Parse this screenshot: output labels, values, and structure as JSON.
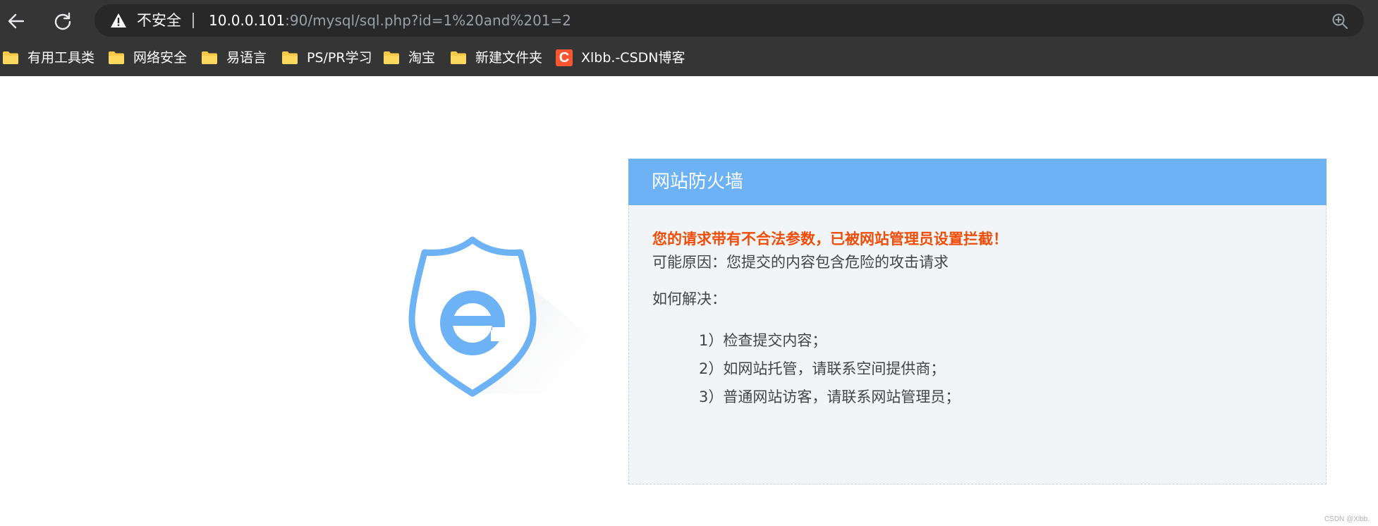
{
  "browser": {
    "security_label": "不安全",
    "url_host": "10.0.0.101",
    "url_rest": ":90/mysql/sql.php?id=1%20and%201=2",
    "icons": {
      "back": "back-arrow-icon",
      "reload": "reload-icon",
      "warning": "warning-triangle-icon",
      "zoom": "zoom-icon"
    }
  },
  "bookmarks": [
    {
      "label": "有用工具类",
      "icon": "folder-icon"
    },
    {
      "label": "网络安全",
      "icon": "folder-icon"
    },
    {
      "label": "易语言",
      "icon": "folder-icon"
    },
    {
      "label": "PS/PR学习",
      "icon": "folder-icon"
    },
    {
      "label": "淘宝",
      "icon": "folder-icon"
    },
    {
      "label": "新建文件夹",
      "icon": "folder-icon"
    },
    {
      "label": "Xlbb.-CSDN博客",
      "icon": "csdn-logo-icon",
      "logo_letter": "C"
    }
  ],
  "waf": {
    "title": "网站防火墙",
    "alert": "您的请求带有不合法参数，已被网站管理员设置拦截！",
    "reason": "可能原因：您提交的内容包含危险的攻击请求",
    "howto": "如何解决：",
    "steps": [
      "1）检查提交内容；",
      "2）如网站托管，请联系空间提供商；",
      "3）普通网站访客，请联系网站管理员；"
    ]
  },
  "watermark": "CSDN @Xlbb.",
  "colors": {
    "chrome_bg": "#353535",
    "omnibox_bg": "#282828",
    "waf_header": "#6cb2f5",
    "waf_body": "#f2f5f7",
    "alert_text": "#f04d08",
    "shield_blue": "#6cb2f5",
    "csdn_red": "#fc5531",
    "folder_yellow": "#f7c948"
  }
}
